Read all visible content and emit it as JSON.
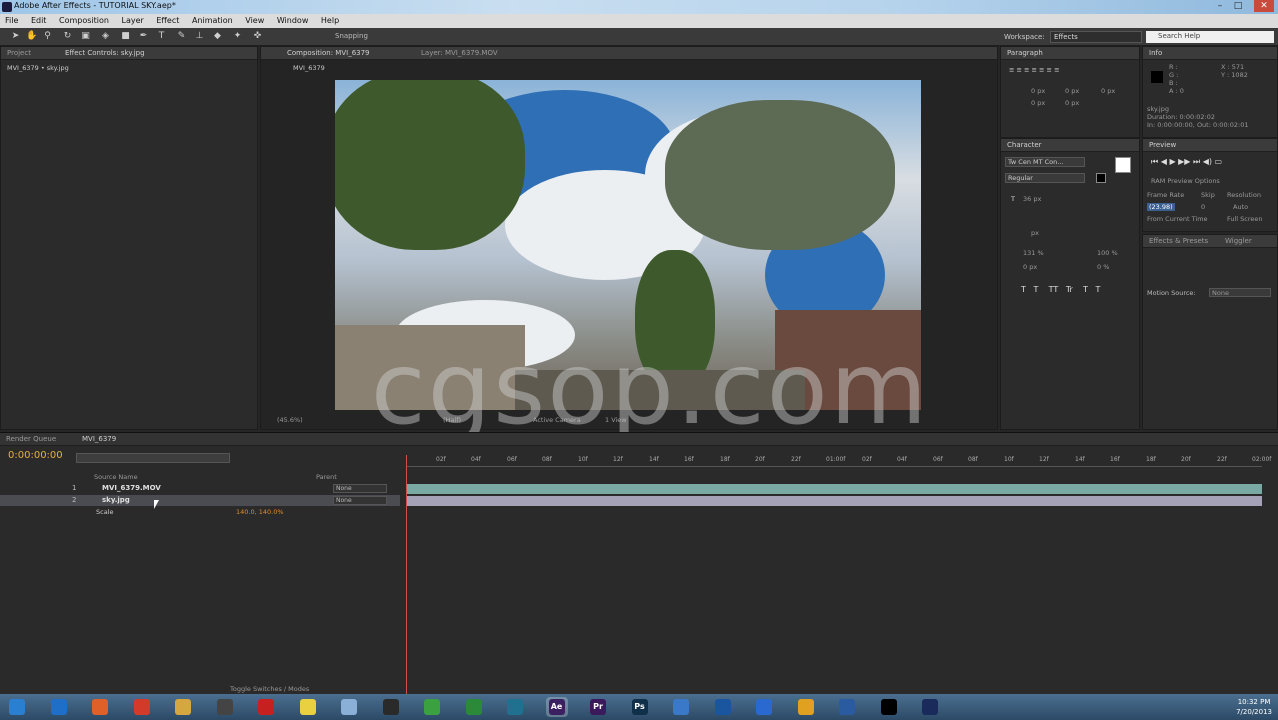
{
  "window": {
    "title": "Adobe After Effects - TUTORIAL SKY.aep*",
    "controls": [
      "–",
      "□",
      "✕"
    ]
  },
  "menu": [
    "File",
    "Edit",
    "Composition",
    "Layer",
    "Effect",
    "Animation",
    "View",
    "Window",
    "Help"
  ],
  "toolbar": {
    "snapping_label": "Snapping",
    "workspace_label": "Workspace:",
    "workspace_value": "Effects",
    "search_placeholder": "Search Help"
  },
  "panels": {
    "project": {
      "tabs": [
        "Project",
        "Effect Controls: sky.jpg"
      ],
      "header": "MVI_6379 • sky.jpg"
    },
    "composition": {
      "tabs": [
        "Composition: MVI_6379",
        "Layer: MVI_6379.MOV"
      ],
      "breadcrumb": "MVI_6379",
      "footer": {
        "zoom": "(45.6%)",
        "resolution": "(Half)",
        "camera": "Active Camera",
        "view": "1 View"
      }
    },
    "paragraph": {
      "tab": "Paragraph",
      "fields": [
        "0 px",
        "0 px",
        "0 px",
        "0 px",
        "0 px"
      ]
    },
    "info": {
      "tab": "Info",
      "rgba": [
        "R :",
        "G :",
        "B :",
        "A : 0"
      ],
      "xy": [
        "X : 571",
        "Y : 1082"
      ],
      "clip": "sky.jpg",
      "duration": "Duration: 0:00:02:02",
      "in_out": "In: 0:00:00:00, Out: 0:00:02:01"
    },
    "character": {
      "tab": "Character",
      "font": "Tw Cen MT Con...",
      "style": "Regular",
      "size": "36 px",
      "tracking_unit": "px",
      "scale_v": "131 %",
      "scale_h": "100 %",
      "baseline": "0 px",
      "tsume": "0 %"
    },
    "preview": {
      "tab": "Preview",
      "ram_options": "RAM Preview Options",
      "frame_rate_label": "Frame Rate",
      "skip_label": "Skip",
      "resolution_label": "Resolution",
      "frame_rate": "(23.98)",
      "skip": "0",
      "resolution": "Auto",
      "from_current": "From Current Time",
      "full_screen": "Full Screen"
    },
    "effects_presets": {
      "tab": "Effects & Presets",
      "tab2": "Wiggler",
      "motion_source_label": "Motion Source:",
      "motion_source_value": "None"
    }
  },
  "timeline": {
    "tabs": [
      "Render Queue",
      "MVI_6379"
    ],
    "timecode": "0:00:00:00",
    "column_header": "Source Name",
    "parent_header": "Parent",
    "layers": [
      {
        "num": "1",
        "name": "MVI_6379.MOV",
        "parent": "None"
      },
      {
        "num": "2",
        "name": "sky.jpg",
        "parent": "None"
      }
    ],
    "property": {
      "name": "Scale",
      "value": "140.0, 140.0%"
    },
    "ruler_labels": [
      "02f",
      "04f",
      "06f",
      "08f",
      "10f",
      "12f",
      "14f",
      "16f",
      "18f",
      "20f",
      "22f",
      "01:00f",
      "02f",
      "04f",
      "06f",
      "08f",
      "10f",
      "12f",
      "14f",
      "16f",
      "18f",
      "20f",
      "22f",
      "02:00f"
    ],
    "footer": "Toggle Switches / Modes"
  },
  "watermark": "cgsop.com",
  "taskbar": {
    "apps": [
      "Start",
      "IE",
      "Firefox",
      "Chrome",
      "Folder",
      "Player",
      "Opera",
      "Tool",
      "Tool",
      "Messenger",
      "Media",
      "MPC",
      "App",
      "Ae",
      "Pr",
      "Ps",
      "Viewer",
      "Tool",
      "Tool",
      "Tool",
      "Network",
      "Tool",
      "Tool"
    ],
    "time": "10:32 PM",
    "date": "7/20/2013"
  }
}
